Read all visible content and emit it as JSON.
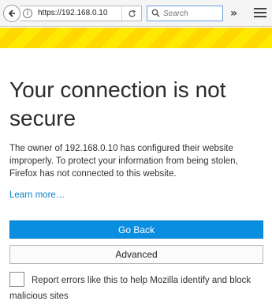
{
  "toolbar": {
    "url": "https://192.168.0.10",
    "search_placeholder": "Search",
    "overflow_glyph": "»"
  },
  "page": {
    "title": "Your connection is not secure",
    "description": "The owner of 192.168.0.10 has configured their website improperly. To protect your information from being stolen, Firefox has not connected to this website.",
    "learn_more": "Learn more…",
    "go_back_label": "Go Back",
    "advanced_label": "Advanced",
    "report_label": "Report errors like this to help Mozilla identify and block malicious sites",
    "report_checked": false
  },
  "colors": {
    "accent": "#0a8ee0",
    "link": "#0a84c9",
    "stripe_yellow": "#ffe900"
  },
  "icons": [
    "back-arrow-icon",
    "info-icon",
    "reload-icon",
    "search-icon",
    "overflow-icon",
    "hamburger-menu-icon"
  ]
}
